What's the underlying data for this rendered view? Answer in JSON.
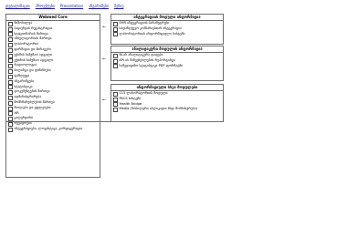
{
  "menu": [
    "დეტალიზაცია",
    "პროექტები",
    "Presentation",
    "ანგარიშები",
    "მენიუ"
  ],
  "left": {
    "title": "Webmed Core",
    "items": [
      {
        "label": "მიმოხილვა",
        "checked": false
      },
      {
        "label": "პაციენტის რეგისტრაცია",
        "checked": false
      },
      {
        "label": "სტაციონარის მართვა",
        "checked": false
      },
      {
        "label": "ამბულატორიის მართვა",
        "checked": false
      },
      {
        "label": "ლაბორატორია",
        "checked": false
      },
      {
        "label": "ფარმაცია და მარაგები",
        "checked": false
      },
      {
        "label": "ექიმის სამუშაო ადგილი",
        "checked": false
      },
      {
        "label": "ექთნის სამუშაო ადგილი",
        "checked": false
      },
      {
        "label": "რადიოლოგია",
        "checked": false
      },
      {
        "label": "ბილინგი და ფინანსები",
        "checked": false
      },
      {
        "label": "დაზღვევა",
        "checked": false
      },
      {
        "label": "ანგარიშგება",
        "checked": false
      },
      {
        "label": "სტატისტიკა",
        "checked": false
      },
      {
        "label": "დოკუმენტების მართვა",
        "checked": false
      },
      {
        "label": "ადმინისტრირება",
        "checked": false
      },
      {
        "label": "მომხმარებლების მართვა",
        "checked": false
      },
      {
        "label": "როლები და უფლებები",
        "checked": false
      },
      {
        "label": "HR",
        "checked": false
      },
      {
        "label": "კალენდარი",
        "checked": false
      },
      {
        "label": "რეესტრები",
        "checked": false
      },
      {
        "label": "ინტეგრაციები, ლოგისტიკა, კონფიგურაცია",
        "checked": false
      }
    ]
  },
  "right1": {
    "title": "ინტეგრაციის მოდული ინფორმაცია",
    "items": [
      {
        "label": "EHR ინტეგრაციის პარამეტრები",
        "checked": false
      },
      {
        "label": "სადაზღვევო კომპანიებთან ინტეგრაცია",
        "checked": false
      },
      {
        "label": "ლაბორატორიის ინფორმაციული სისტემა",
        "checked": false
      }
    ]
  },
  "right2": {
    "title": "ანალიტიკური მოდულის ინფორმაცია",
    "items": [
      {
        "label": "BI-ის ანალიტიკური დაფები",
        "checked": false
      },
      {
        "label": "KPI-ის მაჩვენებლების რეპორტინგი",
        "checked": false
      },
      {
        "label": "სამედიცინო სტატისტიკა PDF ფორმატში",
        "checked": false
      }
    ]
  },
  "right3": {
    "title": "ინფორმაციული სხვა მოდულები",
    "items": [
      {
        "label": "115 ლაბორატორიის მოდული",
        "checked": false
      },
      {
        "label": "PACS სისტემა",
        "checked": false
      },
      {
        "label": "Health Bridge",
        "checked": false
      },
      {
        "label": "Media (მობილური აპლიკაცია სხვა მომსახურება)",
        "checked": false
      }
    ]
  }
}
